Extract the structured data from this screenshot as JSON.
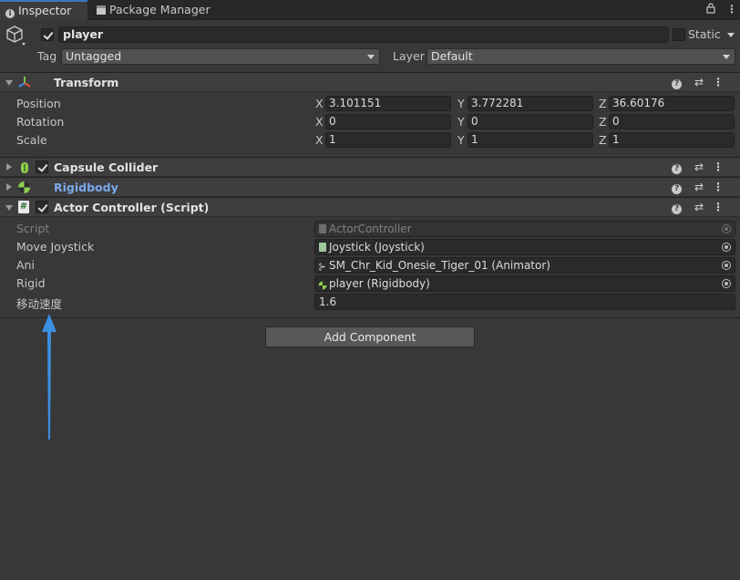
{
  "tabs": [
    {
      "label": "Inspector",
      "icon": "info-icon"
    },
    {
      "label": "Package Manager",
      "icon": "package-icon"
    }
  ],
  "header": {
    "object_name": "player",
    "active": true,
    "static_label": "Static",
    "static": false,
    "tag_label": "Tag",
    "tag_value": "Untagged",
    "layer_label": "Layer",
    "layer_value": "Default"
  },
  "transform": {
    "title": "Transform",
    "rows": [
      {
        "label": "Position",
        "x": "3.101151",
        "y": "3.772281",
        "z": "36.60176"
      },
      {
        "label": "Rotation",
        "x": "0",
        "y": "0",
        "z": "0"
      },
      {
        "label": "Scale",
        "x": "1",
        "y": "1",
        "z": "1"
      }
    ],
    "axis": {
      "x": "X",
      "y": "Y",
      "z": "Z"
    }
  },
  "components": {
    "capsule": {
      "title": "Capsule Collider",
      "enabled": true
    },
    "rigidbody": {
      "title": "Rigidbody"
    },
    "actor": {
      "title": "Actor Controller (Script)",
      "enabled": true,
      "fields": [
        {
          "label": "Script",
          "value": "ActorController",
          "disabled": true
        },
        {
          "label": "Move Joystick",
          "value": "Joystick (Joystick)"
        },
        {
          "label": "Ani",
          "value": "SM_Chr_Kid_Onesie_Tiger_01 (Animator)"
        },
        {
          "label": "Rigid",
          "value": "player (Rigidbody)"
        },
        {
          "label": "移动速度",
          "value": "1.6"
        }
      ]
    }
  },
  "add_component_label": "Add Component",
  "colors": {
    "accent_tab": "#3a79bb",
    "link_blue": "#7aa7ec",
    "annotation_arrow": "#3b8fe0"
  }
}
